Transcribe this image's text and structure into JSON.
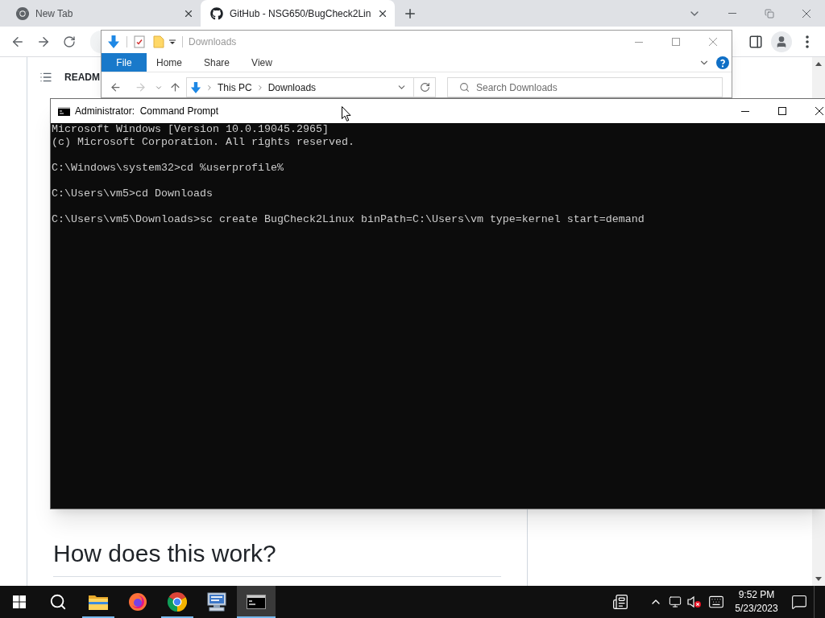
{
  "browser": {
    "tabs": [
      {
        "title": "New Tab",
        "kind": "newtab",
        "selected": false
      },
      {
        "title": "GitHub - NSG650/BugCheck2Lin",
        "kind": "site",
        "selected": true
      }
    ],
    "readme": {
      "header": "READM",
      "heading": "How does this work?"
    }
  },
  "explorer": {
    "title": "Downloads",
    "ribbon_tabs": [
      {
        "label": "File",
        "kind": "menu"
      },
      {
        "label": "Home",
        "kind": "tab"
      },
      {
        "label": "Share",
        "kind": "tab"
      },
      {
        "label": "View",
        "kind": "tab"
      }
    ],
    "back": {
      "disabled": false
    },
    "forward": {
      "disabled": true
    },
    "breadcrumb": [
      "This PC",
      "Downloads"
    ],
    "search": {
      "placeholder": "Search Downloads"
    }
  },
  "cmd": {
    "title": "Administrator:  Command Prompt",
    "output_blocks": [
      [
        "Microsoft Windows [Version 10.0.19045.2965]",
        "(c) Microsoft Corporation. All rights reserved."
      ],
      [
        "C:\\Windows\\system32>cd %userprofile%"
      ],
      [
        "C:\\Users\\vm5>cd Downloads"
      ],
      [
        "C:\\Users\\vm5\\Downloads>sc create BugCheck2Linux binPath=C:\\Users\\vm type=kernel start=demand"
      ]
    ]
  },
  "taskbar": {
    "apps": [
      {
        "kind": "explorer",
        "running": true,
        "selected": false
      },
      {
        "kind": "firefox",
        "running": false,
        "selected": false
      },
      {
        "kind": "chrome",
        "running": true,
        "selected": false
      },
      {
        "kind": "computer",
        "running": false,
        "selected": false
      },
      {
        "kind": "terminal",
        "running": true,
        "selected": true
      }
    ],
    "clock": {
      "time": "9:52 PM",
      "date": "5/23/2023"
    }
  }
}
